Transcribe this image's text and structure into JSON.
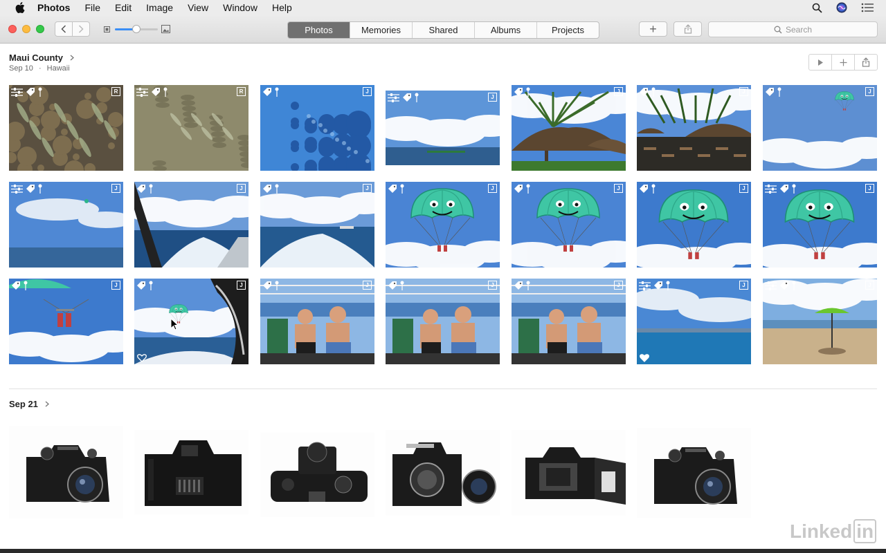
{
  "menubar": {
    "app_name": "Photos",
    "items": [
      "File",
      "Edit",
      "Image",
      "View",
      "Window",
      "Help"
    ]
  },
  "toolbar": {
    "tabs": [
      {
        "label": "Photos",
        "active": true
      },
      {
        "label": "Memories",
        "active": false
      },
      {
        "label": "Shared",
        "active": false
      },
      {
        "label": "Albums",
        "active": false
      },
      {
        "label": "Projects",
        "active": false
      }
    ],
    "search_placeholder": "Search",
    "add_symbol": "+"
  },
  "moment1": {
    "title": "Maui County",
    "date": "Sep 10",
    "separator": "·",
    "place": "Hawaii"
  },
  "moment2": {
    "title": "Sep 21"
  },
  "watermark": {
    "text": "Linked",
    "boxed": "in"
  },
  "colors": {
    "accent": "#3b8ef5",
    "traffic_close": "#fc605c",
    "traffic_min": "#fdbc40",
    "traffic_max": "#34c84a",
    "active_tab": "#707070"
  },
  "icons": {
    "adjust": "sliders-icon",
    "keyword": "tag-icon",
    "location": "pin-icon",
    "favorite": "heart-icon"
  },
  "grid": [
    {
      "kind": "reef",
      "badge": "R",
      "adj": true,
      "tag": true,
      "pin": true
    },
    {
      "kind": "sand",
      "badge": "R",
      "adj": true,
      "tag": true,
      "pin": true
    },
    {
      "kind": "coral",
      "badge": "J",
      "adj": false,
      "tag": true,
      "pin": true
    },
    {
      "kind": "sea",
      "badge": "J",
      "adj": true,
      "tag": true,
      "pin": true
    },
    {
      "kind": "hut",
      "badge": "J",
      "adj": false,
      "tag": true,
      "pin": true
    },
    {
      "kind": "resort",
      "badge": "J",
      "adj": false,
      "tag": true,
      "pin": true
    },
    {
      "kind": "parasky",
      "badge": "J",
      "adj": false,
      "tag": true,
      "pin": true
    },
    {
      "kind": "skyocean",
      "badge": "J",
      "adj": true,
      "tag": true,
      "pin": true
    },
    {
      "kind": "wake",
      "badge": "J",
      "adj": false,
      "tag": true,
      "pin": true
    },
    {
      "kind": "wake2",
      "badge": "J",
      "adj": false,
      "tag": true,
      "pin": true
    },
    {
      "kind": "chute",
      "badge": "J",
      "adj": false,
      "tag": true,
      "pin": true
    },
    {
      "kind": "chute",
      "badge": "J",
      "adj": false,
      "tag": true,
      "pin": true
    },
    {
      "kind": "chute2",
      "badge": "J",
      "adj": false,
      "tag": true,
      "pin": true
    },
    {
      "kind": "chute2",
      "badge": "J",
      "adj": true,
      "tag": true,
      "pin": true
    },
    {
      "kind": "riders",
      "badge": "J",
      "adj": false,
      "tag": true,
      "pin": true
    },
    {
      "kind": "boatchute",
      "badge": "J",
      "adj": false,
      "tag": true,
      "pin": true,
      "heart": "outline"
    },
    {
      "kind": "boys",
      "badge": "J",
      "adj": false,
      "tag": true,
      "pin": true
    },
    {
      "kind": "boys",
      "badge": "J",
      "adj": false,
      "tag": true,
      "pin": true
    },
    {
      "kind": "boys",
      "badge": "J",
      "adj": false,
      "tag": true,
      "pin": true
    },
    {
      "kind": "ocean",
      "badge": "J",
      "adj": true,
      "tag": true,
      "pin": true,
      "heart": "filled"
    },
    {
      "kind": "beach",
      "badge": "J",
      "adj": true,
      "tag": true,
      "pin": true
    }
  ],
  "cameras": [
    {
      "kind": "cam-front"
    },
    {
      "kind": "cam-back"
    },
    {
      "kind": "cam-top",
      "adj": true
    },
    {
      "kind": "cam-nolens"
    },
    {
      "kind": "cam-open"
    },
    {
      "kind": "cam-front"
    }
  ]
}
